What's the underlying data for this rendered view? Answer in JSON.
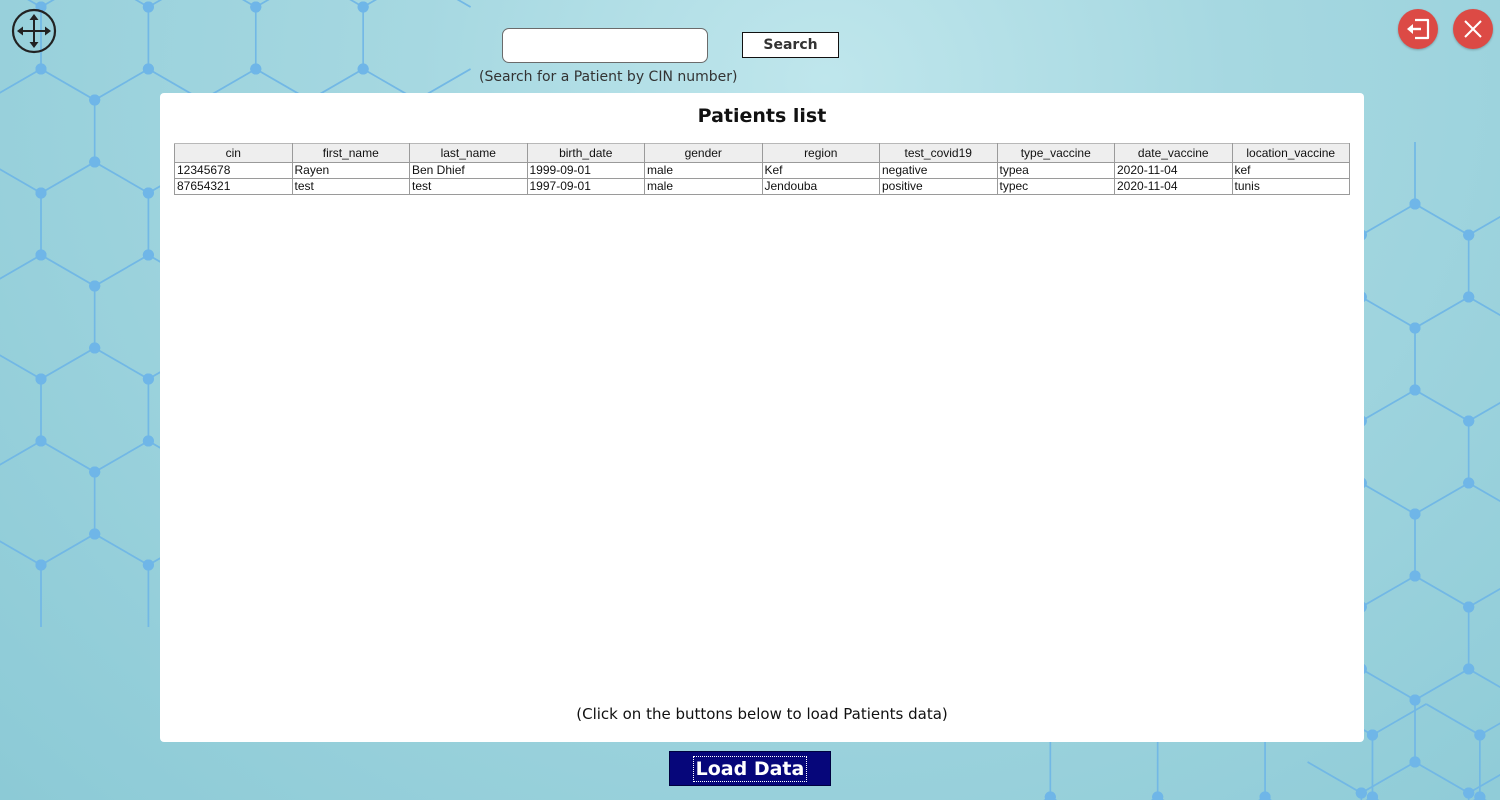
{
  "search": {
    "value": "",
    "placeholder": "",
    "button_label": "Search",
    "hint": "(Search for a Patient by CIN number)"
  },
  "window_controls": {
    "move_icon": "move-arrows-icon",
    "logout_icon": "logout-icon",
    "close_icon": "close-icon",
    "accent_color": "#dc4a45"
  },
  "panel": {
    "title": "Patients list",
    "hint": "(Click on the buttons below to load Patients data)"
  },
  "table": {
    "columns": [
      "cin",
      "first_name",
      "last_name",
      "birth_date",
      "gender",
      "region",
      "test_covid19",
      "type_vaccine",
      "date_vaccine",
      "location_vaccine"
    ],
    "rows": [
      [
        "12345678",
        "Rayen",
        "Ben Dhief",
        "1999-09-01",
        "male",
        "Kef",
        "negative",
        "typea",
        "2020-11-04",
        "kef"
      ],
      [
        "87654321",
        "test",
        "test",
        "1997-09-01",
        "male",
        "Jendouba",
        "positive",
        "typec",
        "2020-11-04",
        "tunis"
      ]
    ]
  },
  "load_button": {
    "label": "Load Data",
    "color": "#06067a"
  }
}
